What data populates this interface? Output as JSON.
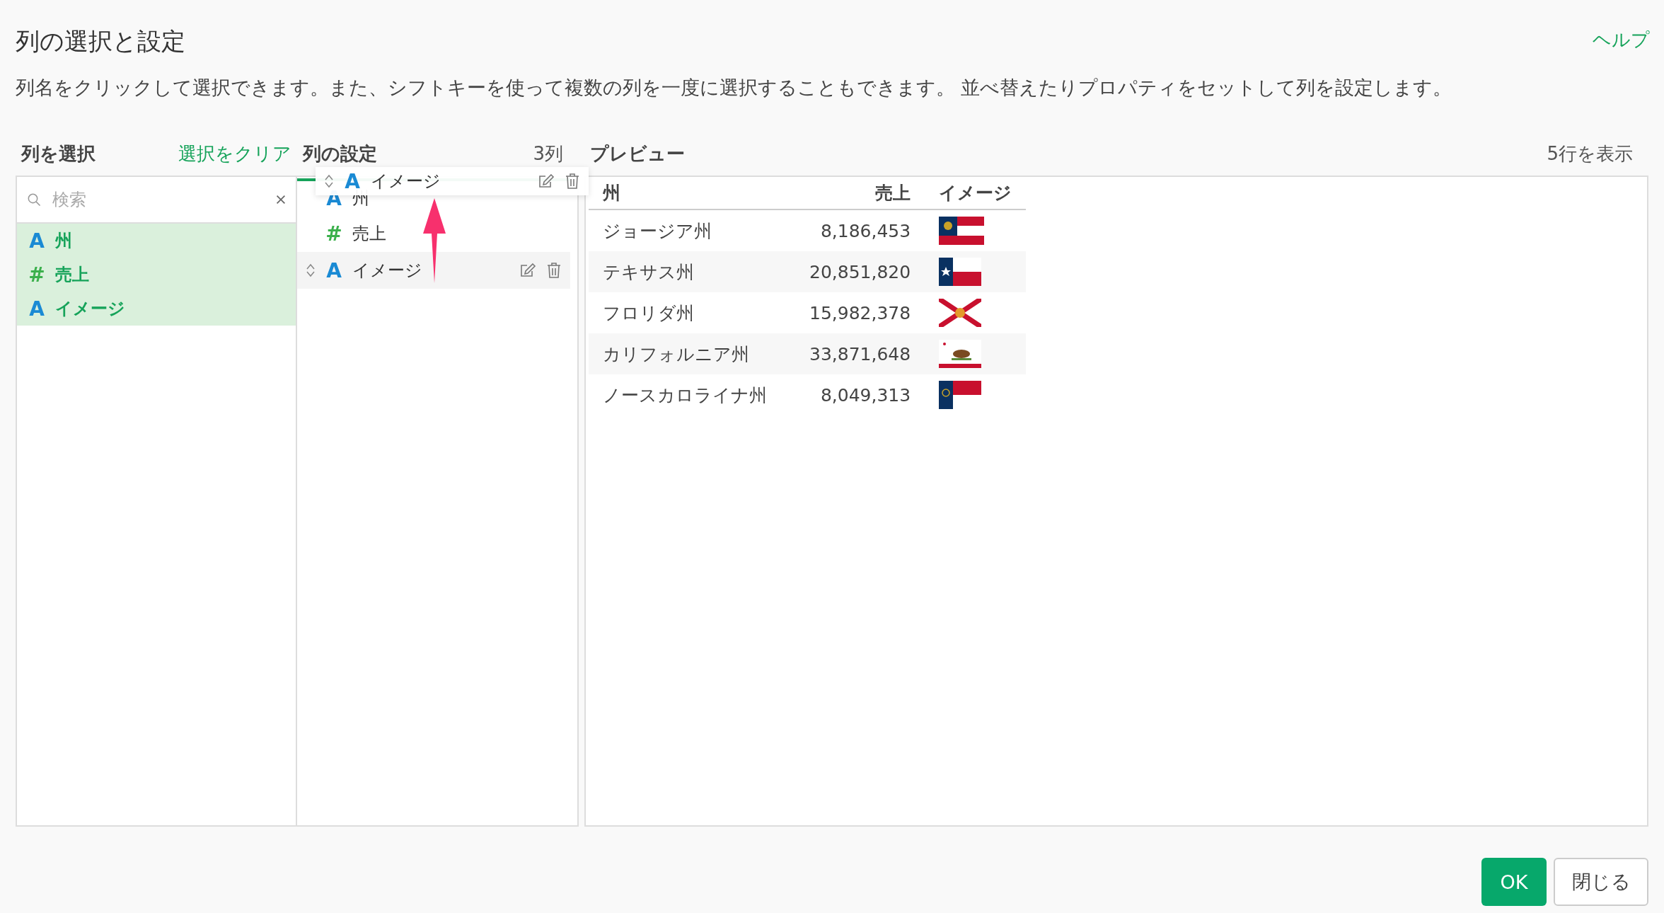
{
  "dialog": {
    "title": "列の選択と設定",
    "help_link": "ヘルプ",
    "description": "列名をクリックして選択できます。また、シフトキーを使って複数の列を一度に選択することもできます。 並べ替えたりプロパティをセットして列を設定します。"
  },
  "select_panel": {
    "heading": "列を選択",
    "clear_link": "選択をクリア",
    "search": {
      "placeholder": "検索"
    },
    "items": [
      {
        "kind": "text",
        "type_icon": "A",
        "label": "州",
        "selected": true
      },
      {
        "kind": "number",
        "type_icon": "#",
        "label": "売上",
        "selected": true
      },
      {
        "kind": "text",
        "type_icon": "A",
        "label": "イメージ",
        "selected": true
      }
    ]
  },
  "settings_panel": {
    "heading": "列の設定",
    "count": "3列",
    "items": [
      {
        "kind": "text",
        "type_icon": "A",
        "label": "州",
        "hovered": false
      },
      {
        "kind": "number",
        "type_icon": "#",
        "label": "売上",
        "hovered": false
      },
      {
        "kind": "text",
        "type_icon": "A",
        "label": "イメージ",
        "hovered": true
      }
    ],
    "drag_ghost": {
      "kind": "text",
      "type_icon": "A",
      "label": "イメージ"
    }
  },
  "preview": {
    "heading": "プレビュー",
    "rows_shown": "5行を表示",
    "columns": [
      "州",
      "売上",
      "イメージ"
    ],
    "rows": [
      {
        "state": "ジョージア州",
        "sales": "8,186,453"
      },
      {
        "state": "テキサス州",
        "sales": "20,851,820"
      },
      {
        "state": "フロリダ州",
        "sales": "15,982,378"
      },
      {
        "state": "カリフォルニア州",
        "sales": "33,871,648"
      },
      {
        "state": "ノースカロライナ州",
        "sales": "8,049,313"
      }
    ]
  },
  "buttons": [
    {
      "kind": "primary",
      "label": "OK"
    },
    {
      "kind": "secondary",
      "label": "閉じる"
    }
  ]
}
